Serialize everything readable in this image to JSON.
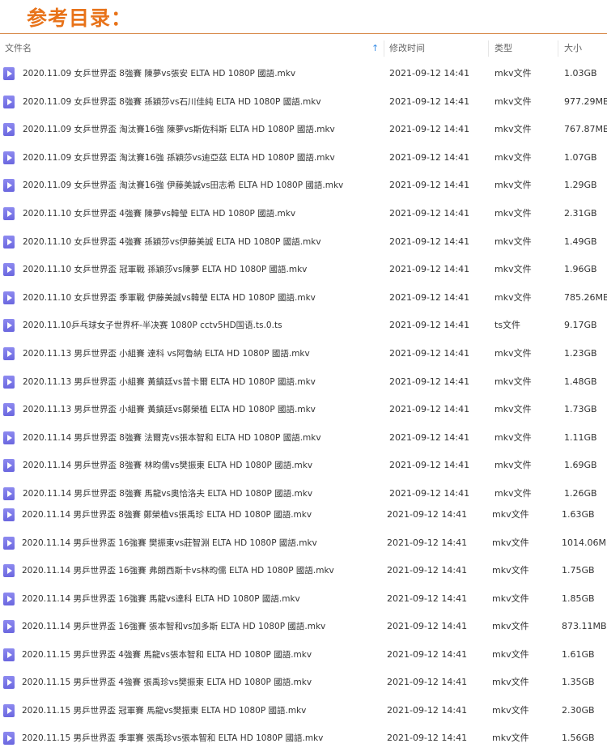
{
  "page_title": "参考目录：",
  "columns": {
    "name": "文件名",
    "modified": "修改时间",
    "type": "类型",
    "size": "大小"
  },
  "files": [
    {
      "name": "2020.11.09 女乒世界盃 8強賽 陳夢vs張安 ELTA HD 1080P 國語.mkv",
      "modified": "2021-09-12 14:41",
      "type": "mkv文件",
      "size": "1.03GB"
    },
    {
      "name": "2020.11.09 女乒世界盃 8強賽 孫穎莎vs石川佳純 ELTA HD 1080P 國語.mkv",
      "modified": "2021-09-12 14:41",
      "type": "mkv文件",
      "size": "977.29MB"
    },
    {
      "name": "2020.11.09 女乒世界盃 淘汰賽16強 陳夢vs斯佐科斯 ELTA HD 1080P 國語.mkv",
      "modified": "2021-09-12 14:41",
      "type": "mkv文件",
      "size": "767.87MB"
    },
    {
      "name": "2020.11.09 女乒世界盃 淘汰賽16強 孫穎莎vs迪亞茲 ELTA HD 1080P 國語.mkv",
      "modified": "2021-09-12 14:41",
      "type": "mkv文件",
      "size": "1.07GB"
    },
    {
      "name": "2020.11.09 女乒世界盃 淘汰賽16強 伊藤美誠vs田志希 ELTA HD 1080P 國語.mkv",
      "modified": "2021-09-12 14:41",
      "type": "mkv文件",
      "size": "1.29GB"
    },
    {
      "name": "2020.11.10 女乒世界盃 4強賽 陳夢vs韓瑩 ELTA HD 1080P 國語.mkv",
      "modified": "2021-09-12 14:41",
      "type": "mkv文件",
      "size": "2.31GB"
    },
    {
      "name": "2020.11.10 女乒世界盃 4強賽 孫穎莎vs伊藤美誠 ELTA HD 1080P 國語.mkv",
      "modified": "2021-09-12 14:41",
      "type": "mkv文件",
      "size": "1.49GB"
    },
    {
      "name": "2020.11.10 女乒世界盃 冠軍戰 孫穎莎vs陳夢 ELTA HD 1080P 國語.mkv",
      "modified": "2021-09-12 14:41",
      "type": "mkv文件",
      "size": "1.96GB"
    },
    {
      "name": "2020.11.10 女乒世界盃 季軍戰 伊藤美誠vs韓瑩 ELTA HD 1080P 國語.mkv",
      "modified": "2021-09-12 14:41",
      "type": "mkv文件",
      "size": "785.26MB"
    },
    {
      "name": "2020.11.10乒乓球女子世界杯-半决赛 1080P  cctv5HD国语.ts.0.ts",
      "modified": "2021-09-12 14:41",
      "type": "ts文件",
      "size": "9.17GB"
    },
    {
      "name": "2020.11.13 男乒世界盃 小組賽 達科 vs阿魯納 ELTA HD 1080P 國語.mkv",
      "modified": "2021-09-12 14:41",
      "type": "mkv文件",
      "size": "1.23GB"
    },
    {
      "name": "2020.11.13 男乒世界盃 小組賽 黃鎮廷vs普卡爾 ELTA HD 1080P 國語.mkv",
      "modified": "2021-09-12 14:41",
      "type": "mkv文件",
      "size": "1.48GB"
    },
    {
      "name": "2020.11.13 男乒世界盃 小組賽 黃鎮廷vs鄭榮植 ELTA HD 1080P 國語.mkv",
      "modified": "2021-09-12 14:41",
      "type": "mkv文件",
      "size": "1.73GB"
    },
    {
      "name": "2020.11.14 男乒世界盃 8強賽 法爾克vs張本智和 ELTA HD 1080P 國語.mkv",
      "modified": "2021-09-12 14:41",
      "type": "mkv文件",
      "size": "1.11GB"
    },
    {
      "name": "2020.11.14 男乒世界盃 8強賽 林昀儒vs樊振東 ELTA HD 1080P 國語.mkv",
      "modified": "2021-09-12 14:41",
      "type": "mkv文件",
      "size": "1.69GB"
    },
    {
      "name": "2020.11.14 男乒世界盃 8強賽 馬龍vs奧恰洛夫 ELTA HD 1080P 國語.mkv",
      "modified": "2021-09-12 14:41",
      "type": "mkv文件",
      "size": "1.26GB"
    },
    {
      "name": "2020.11.14 男乒世界盃 8強賽 鄭榮植vs張禹珍 ELTA HD 1080P 國語.mkv",
      "modified": "2021-09-12 14:41",
      "type": "mkv文件",
      "size": "1.63GB"
    },
    {
      "name": "2020.11.14 男乒世界盃 16強賽 樊振東vs莊智淵 ELTA HD 1080P 國語.mkv",
      "modified": "2021-09-12 14:41",
      "type": "mkv文件",
      "size": "1014.06MB"
    },
    {
      "name": "2020.11.14 男乒世界盃 16強賽 弗朗西斯卡vs林昀儒 ELTA HD 1080P 國語.mkv",
      "modified": "2021-09-12 14:41",
      "type": "mkv文件",
      "size": "1.75GB"
    },
    {
      "name": "2020.11.14 男乒世界盃 16強賽 馬龍vs達科 ELTA HD 1080P 國語.mkv",
      "modified": "2021-09-12 14:41",
      "type": "mkv文件",
      "size": "1.85GB"
    },
    {
      "name": "2020.11.14 男乒世界盃 16強賽 張本智和vs加多斯 ELTA HD 1080P 國語.mkv",
      "modified": "2021-09-12 14:41",
      "type": "mkv文件",
      "size": "873.11MB"
    },
    {
      "name": "2020.11.15 男乒世界盃 4強賽 馬龍vs張本智和 ELTA HD 1080P 國語.mkv",
      "modified": "2021-09-12 14:41",
      "type": "mkv文件",
      "size": "1.61GB"
    },
    {
      "name": "2020.11.15 男乒世界盃 4強賽 張禹珍vs樊振東 ELTA HD 1080P 國語.mkv",
      "modified": "2021-09-12 14:41",
      "type": "mkv文件",
      "size": "1.35GB"
    },
    {
      "name": "2020.11.15 男乒世界盃 冠軍賽 馬龍vs樊振東 ELTA HD 1080P 國語.mkv",
      "modified": "2021-09-12 14:41",
      "type": "mkv文件",
      "size": "2.30GB"
    },
    {
      "name": "2020.11.15 男乒世界盃 季軍賽 張禹珍vs張本智和 ELTA HD 1080P 國語.mkv",
      "modified": "2021-09-12 14:41",
      "type": "mkv文件",
      "size": "1.56GB"
    }
  ]
}
